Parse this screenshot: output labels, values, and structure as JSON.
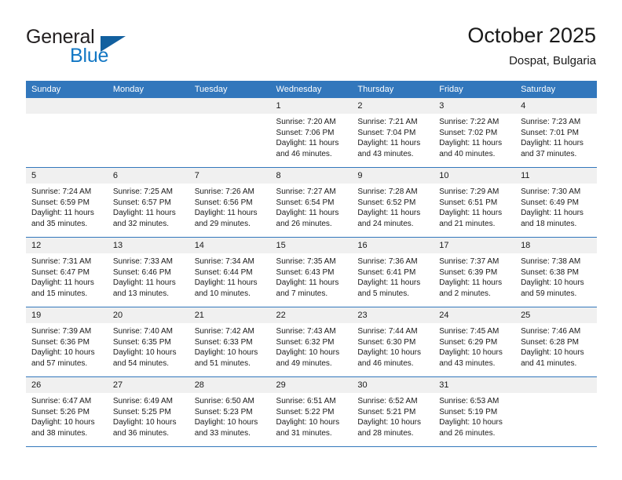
{
  "brand": {
    "line1": "General",
    "line2": "Blue",
    "logo_color": "#12609f",
    "text_color": "#1277c4"
  },
  "header": {
    "title": "October 2025",
    "location": "Dospat, Bulgaria",
    "accent_color": "#3277bc",
    "daynum_background": "#f0f0f0"
  },
  "weekday_headers": [
    "Sunday",
    "Monday",
    "Tuesday",
    "Wednesday",
    "Thursday",
    "Friday",
    "Saturday"
  ],
  "weeks": [
    [
      {
        "day": "",
        "empty": true,
        "sunrise": "",
        "sunset": "",
        "daylight1": "",
        "daylight2": ""
      },
      {
        "day": "",
        "empty": true,
        "sunrise": "",
        "sunset": "",
        "daylight1": "",
        "daylight2": ""
      },
      {
        "day": "",
        "empty": true,
        "sunrise": "",
        "sunset": "",
        "daylight1": "",
        "daylight2": ""
      },
      {
        "day": "1",
        "empty": false,
        "sunrise": "Sunrise: 7:20 AM",
        "sunset": "Sunset: 7:06 PM",
        "daylight1": "Daylight: 11 hours",
        "daylight2": "and 46 minutes."
      },
      {
        "day": "2",
        "empty": false,
        "sunrise": "Sunrise: 7:21 AM",
        "sunset": "Sunset: 7:04 PM",
        "daylight1": "Daylight: 11 hours",
        "daylight2": "and 43 minutes."
      },
      {
        "day": "3",
        "empty": false,
        "sunrise": "Sunrise: 7:22 AM",
        "sunset": "Sunset: 7:02 PM",
        "daylight1": "Daylight: 11 hours",
        "daylight2": "and 40 minutes."
      },
      {
        "day": "4",
        "empty": false,
        "sunrise": "Sunrise: 7:23 AM",
        "sunset": "Sunset: 7:01 PM",
        "daylight1": "Daylight: 11 hours",
        "daylight2": "and 37 minutes."
      }
    ],
    [
      {
        "day": "5",
        "empty": false,
        "sunrise": "Sunrise: 7:24 AM",
        "sunset": "Sunset: 6:59 PM",
        "daylight1": "Daylight: 11 hours",
        "daylight2": "and 35 minutes."
      },
      {
        "day": "6",
        "empty": false,
        "sunrise": "Sunrise: 7:25 AM",
        "sunset": "Sunset: 6:57 PM",
        "daylight1": "Daylight: 11 hours",
        "daylight2": "and 32 minutes."
      },
      {
        "day": "7",
        "empty": false,
        "sunrise": "Sunrise: 7:26 AM",
        "sunset": "Sunset: 6:56 PM",
        "daylight1": "Daylight: 11 hours",
        "daylight2": "and 29 minutes."
      },
      {
        "day": "8",
        "empty": false,
        "sunrise": "Sunrise: 7:27 AM",
        "sunset": "Sunset: 6:54 PM",
        "daylight1": "Daylight: 11 hours",
        "daylight2": "and 26 minutes."
      },
      {
        "day": "9",
        "empty": false,
        "sunrise": "Sunrise: 7:28 AM",
        "sunset": "Sunset: 6:52 PM",
        "daylight1": "Daylight: 11 hours",
        "daylight2": "and 24 minutes."
      },
      {
        "day": "10",
        "empty": false,
        "sunrise": "Sunrise: 7:29 AM",
        "sunset": "Sunset: 6:51 PM",
        "daylight1": "Daylight: 11 hours",
        "daylight2": "and 21 minutes."
      },
      {
        "day": "11",
        "empty": false,
        "sunrise": "Sunrise: 7:30 AM",
        "sunset": "Sunset: 6:49 PM",
        "daylight1": "Daylight: 11 hours",
        "daylight2": "and 18 minutes."
      }
    ],
    [
      {
        "day": "12",
        "empty": false,
        "sunrise": "Sunrise: 7:31 AM",
        "sunset": "Sunset: 6:47 PM",
        "daylight1": "Daylight: 11 hours",
        "daylight2": "and 15 minutes."
      },
      {
        "day": "13",
        "empty": false,
        "sunrise": "Sunrise: 7:33 AM",
        "sunset": "Sunset: 6:46 PM",
        "daylight1": "Daylight: 11 hours",
        "daylight2": "and 13 minutes."
      },
      {
        "day": "14",
        "empty": false,
        "sunrise": "Sunrise: 7:34 AM",
        "sunset": "Sunset: 6:44 PM",
        "daylight1": "Daylight: 11 hours",
        "daylight2": "and 10 minutes."
      },
      {
        "day": "15",
        "empty": false,
        "sunrise": "Sunrise: 7:35 AM",
        "sunset": "Sunset: 6:43 PM",
        "daylight1": "Daylight: 11 hours",
        "daylight2": "and 7 minutes."
      },
      {
        "day": "16",
        "empty": false,
        "sunrise": "Sunrise: 7:36 AM",
        "sunset": "Sunset: 6:41 PM",
        "daylight1": "Daylight: 11 hours",
        "daylight2": "and 5 minutes."
      },
      {
        "day": "17",
        "empty": false,
        "sunrise": "Sunrise: 7:37 AM",
        "sunset": "Sunset: 6:39 PM",
        "daylight1": "Daylight: 11 hours",
        "daylight2": "and 2 minutes."
      },
      {
        "day": "18",
        "empty": false,
        "sunrise": "Sunrise: 7:38 AM",
        "sunset": "Sunset: 6:38 PM",
        "daylight1": "Daylight: 10 hours",
        "daylight2": "and 59 minutes."
      }
    ],
    [
      {
        "day": "19",
        "empty": false,
        "sunrise": "Sunrise: 7:39 AM",
        "sunset": "Sunset: 6:36 PM",
        "daylight1": "Daylight: 10 hours",
        "daylight2": "and 57 minutes."
      },
      {
        "day": "20",
        "empty": false,
        "sunrise": "Sunrise: 7:40 AM",
        "sunset": "Sunset: 6:35 PM",
        "daylight1": "Daylight: 10 hours",
        "daylight2": "and 54 minutes."
      },
      {
        "day": "21",
        "empty": false,
        "sunrise": "Sunrise: 7:42 AM",
        "sunset": "Sunset: 6:33 PM",
        "daylight1": "Daylight: 10 hours",
        "daylight2": "and 51 minutes."
      },
      {
        "day": "22",
        "empty": false,
        "sunrise": "Sunrise: 7:43 AM",
        "sunset": "Sunset: 6:32 PM",
        "daylight1": "Daylight: 10 hours",
        "daylight2": "and 49 minutes."
      },
      {
        "day": "23",
        "empty": false,
        "sunrise": "Sunrise: 7:44 AM",
        "sunset": "Sunset: 6:30 PM",
        "daylight1": "Daylight: 10 hours",
        "daylight2": "and 46 minutes."
      },
      {
        "day": "24",
        "empty": false,
        "sunrise": "Sunrise: 7:45 AM",
        "sunset": "Sunset: 6:29 PM",
        "daylight1": "Daylight: 10 hours",
        "daylight2": "and 43 minutes."
      },
      {
        "day": "25",
        "empty": false,
        "sunrise": "Sunrise: 7:46 AM",
        "sunset": "Sunset: 6:28 PM",
        "daylight1": "Daylight: 10 hours",
        "daylight2": "and 41 minutes."
      }
    ],
    [
      {
        "day": "26",
        "empty": false,
        "sunrise": "Sunrise: 6:47 AM",
        "sunset": "Sunset: 5:26 PM",
        "daylight1": "Daylight: 10 hours",
        "daylight2": "and 38 minutes."
      },
      {
        "day": "27",
        "empty": false,
        "sunrise": "Sunrise: 6:49 AM",
        "sunset": "Sunset: 5:25 PM",
        "daylight1": "Daylight: 10 hours",
        "daylight2": "and 36 minutes."
      },
      {
        "day": "28",
        "empty": false,
        "sunrise": "Sunrise: 6:50 AM",
        "sunset": "Sunset: 5:23 PM",
        "daylight1": "Daylight: 10 hours",
        "daylight2": "and 33 minutes."
      },
      {
        "day": "29",
        "empty": false,
        "sunrise": "Sunrise: 6:51 AM",
        "sunset": "Sunset: 5:22 PM",
        "daylight1": "Daylight: 10 hours",
        "daylight2": "and 31 minutes."
      },
      {
        "day": "30",
        "empty": false,
        "sunrise": "Sunrise: 6:52 AM",
        "sunset": "Sunset: 5:21 PM",
        "daylight1": "Daylight: 10 hours",
        "daylight2": "and 28 minutes."
      },
      {
        "day": "31",
        "empty": false,
        "sunrise": "Sunrise: 6:53 AM",
        "sunset": "Sunset: 5:19 PM",
        "daylight1": "Daylight: 10 hours",
        "daylight2": "and 26 minutes."
      },
      {
        "day": "",
        "empty": true,
        "sunrise": "",
        "sunset": "",
        "daylight1": "",
        "daylight2": ""
      }
    ]
  ]
}
